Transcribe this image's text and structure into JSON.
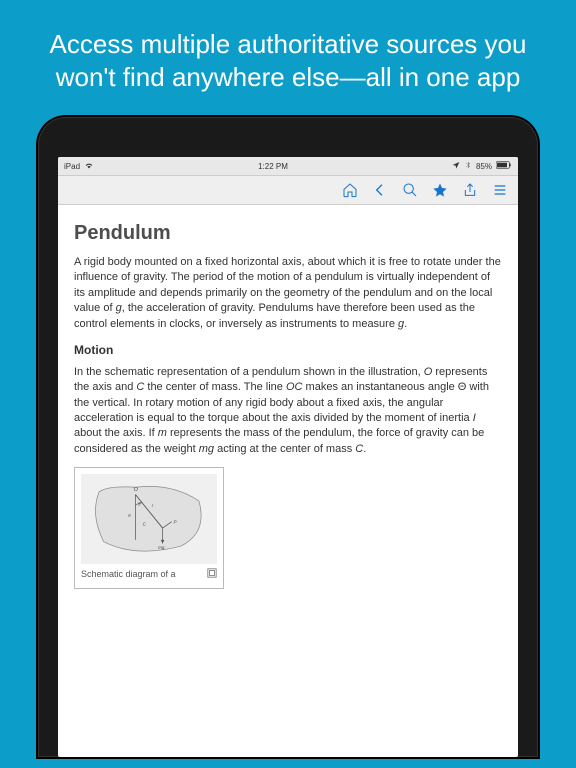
{
  "promo": "Access multiple authoritative sources you won't find anywhere else—all in one app",
  "status": {
    "device": "iPad",
    "wifi": "wifi",
    "time": "1:22 PM",
    "battery": "85%"
  },
  "article": {
    "title": "Pendulum",
    "intro_a": "A rigid body mounted on a fixed horizontal axis, about which it is free to rotate under the influence of gravity. The period of the motion of a pendulum is virtually independent of its amplitude and depends primarily on the geometry of the pendulum and on the local value of ",
    "intro_g1": "g",
    "intro_b": ", the acceleration of gravity. Pendulums have therefore been used as the control elements in clocks, or inversely as instruments to measure ",
    "intro_g2": "g",
    "intro_c": ".",
    "motion_heading": "Motion",
    "motion_a": "In the schematic representation of a pendulum shown in the illustration, ",
    "motion_O": "O",
    "motion_b": " represents the axis and ",
    "motion_C": "C",
    "motion_c": " the center of mass. The line ",
    "motion_OC": "OC",
    "motion_d": " makes an instantaneous angle Θ with the vertical. In rotary motion of any rigid body about a fixed axis, the angular acceleration is equal to the torque about the axis divided by the moment of inertia ",
    "motion_I": "I",
    "motion_e": " about the axis. If ",
    "motion_m": "m",
    "motion_f": " represents the mass of the pendulum, the force of gravity can be considered as the weight ",
    "motion_mg": "mg",
    "motion_g": " acting at the center of mass ",
    "motion_C2": "C",
    "motion_h": ".",
    "fig_caption": "Schematic diagram of a"
  }
}
